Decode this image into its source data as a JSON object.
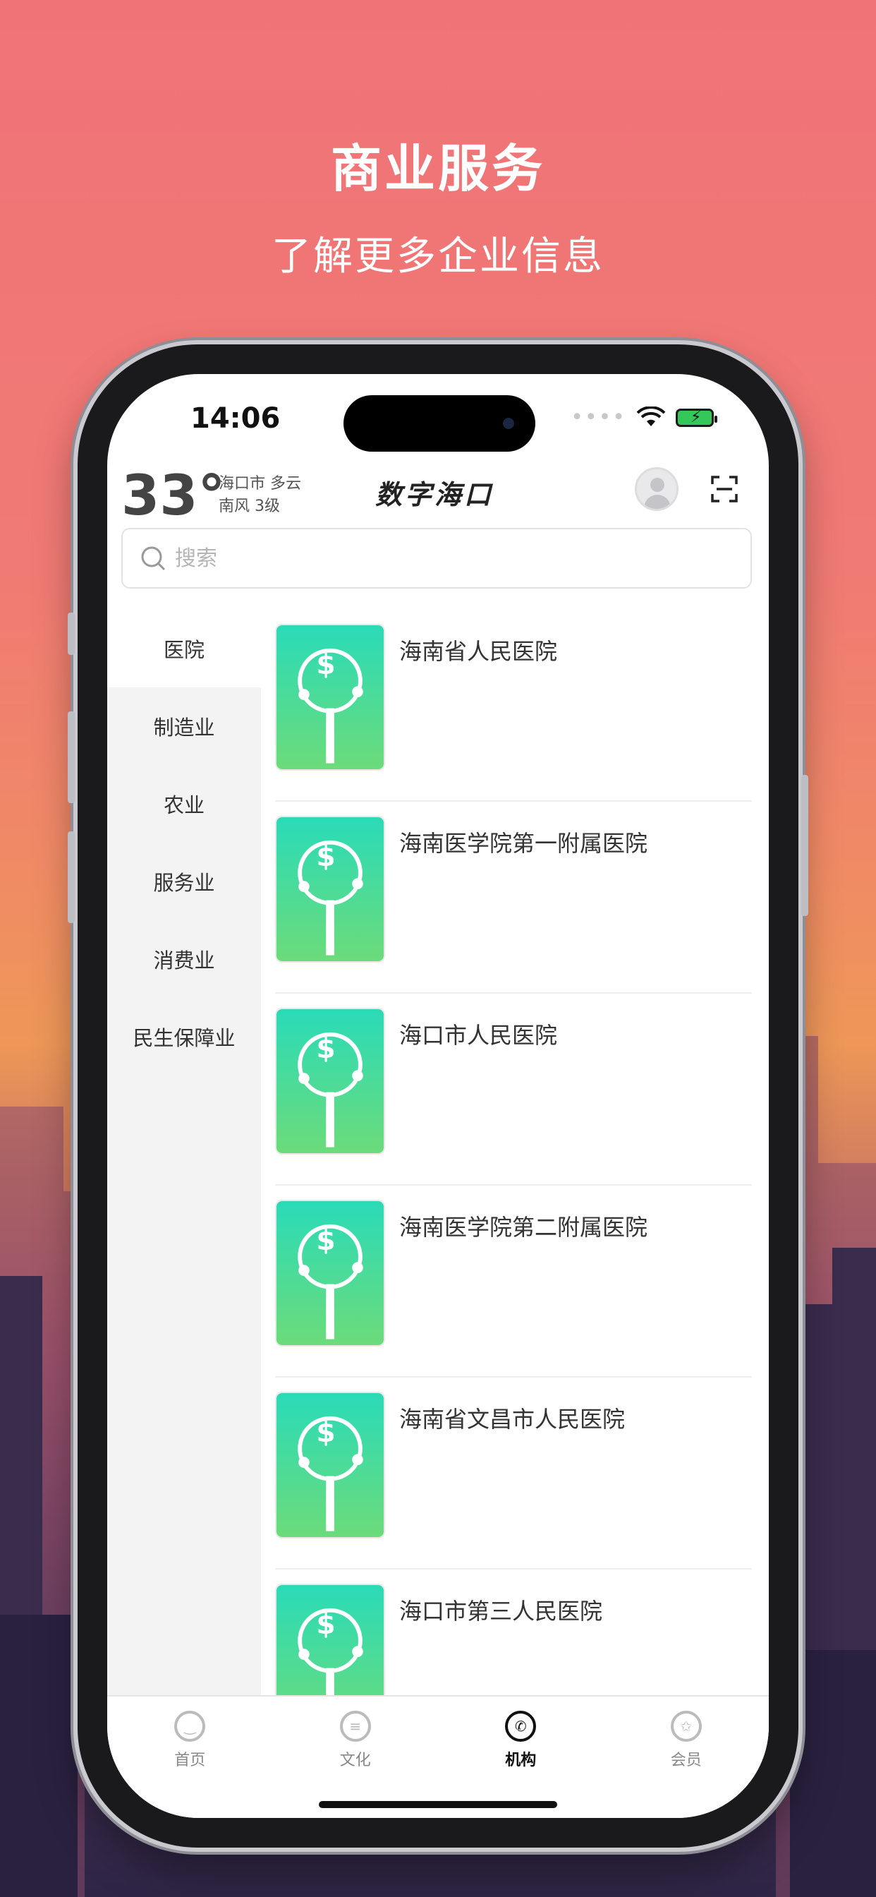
{
  "promo": {
    "title": "商业服务",
    "subtitle": "了解更多企业信息"
  },
  "status_bar": {
    "time": "14:06"
  },
  "header": {
    "temperature": "33°",
    "weather_line1": "海口市 多云",
    "weather_line2": "南风 3级",
    "app_title": "数字海口"
  },
  "search": {
    "placeholder": "搜索"
  },
  "categories": [
    {
      "label": "医院",
      "active": true
    },
    {
      "label": "制造业"
    },
    {
      "label": "农业"
    },
    {
      "label": "服务业"
    },
    {
      "label": "消费业"
    },
    {
      "label": "民生保障业"
    }
  ],
  "institutions": [
    {
      "name": "海南省人民医院"
    },
    {
      "name": "海南医学院第一附属医院"
    },
    {
      "name": "海口市人民医院"
    },
    {
      "name": "海南医学院第二附属医院"
    },
    {
      "name": "海南省文昌市人民医院"
    },
    {
      "name": "海口市第三人民医院"
    }
  ],
  "tabbar": [
    {
      "label": "首页",
      "icon": "home-icon"
    },
    {
      "label": "文化",
      "icon": "culture-icon"
    },
    {
      "label": "机构",
      "icon": "institution-icon",
      "active": true
    },
    {
      "label": "会员",
      "icon": "member-icon"
    }
  ],
  "colors": {
    "thumb_top": "#2adbb8",
    "thumb_bottom": "#6cdb7a",
    "battery": "#34c759"
  }
}
